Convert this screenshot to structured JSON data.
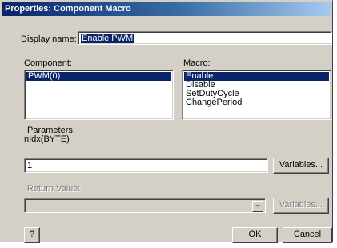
{
  "window": {
    "title": "Properties: Component Macro"
  },
  "display_name": {
    "label": "Display name:",
    "value": "Enable PWM"
  },
  "component": {
    "label": "Component:",
    "items": [
      "PWM(0)"
    ],
    "selected_index": 0
  },
  "macro": {
    "label": "Macro:",
    "items": [
      "Enable",
      "Disable",
      "SetDutyCycle",
      "ChangePeriod"
    ],
    "selected_index": 0
  },
  "parameters": {
    "label": "Parameters:",
    "signature": "nIdx(BYTE)",
    "value": "1",
    "variables_button": "Variables..."
  },
  "return_value": {
    "label": "Return Value:",
    "value": "",
    "variables_button": "Variables..."
  },
  "buttons": {
    "help": "?",
    "ok": "OK",
    "cancel": "Cancel"
  },
  "colors": {
    "face": "#d4d0c8",
    "selection": "#0a246a",
    "title_gradient_start": "#0a246a",
    "title_gradient_end": "#a6caf0"
  }
}
